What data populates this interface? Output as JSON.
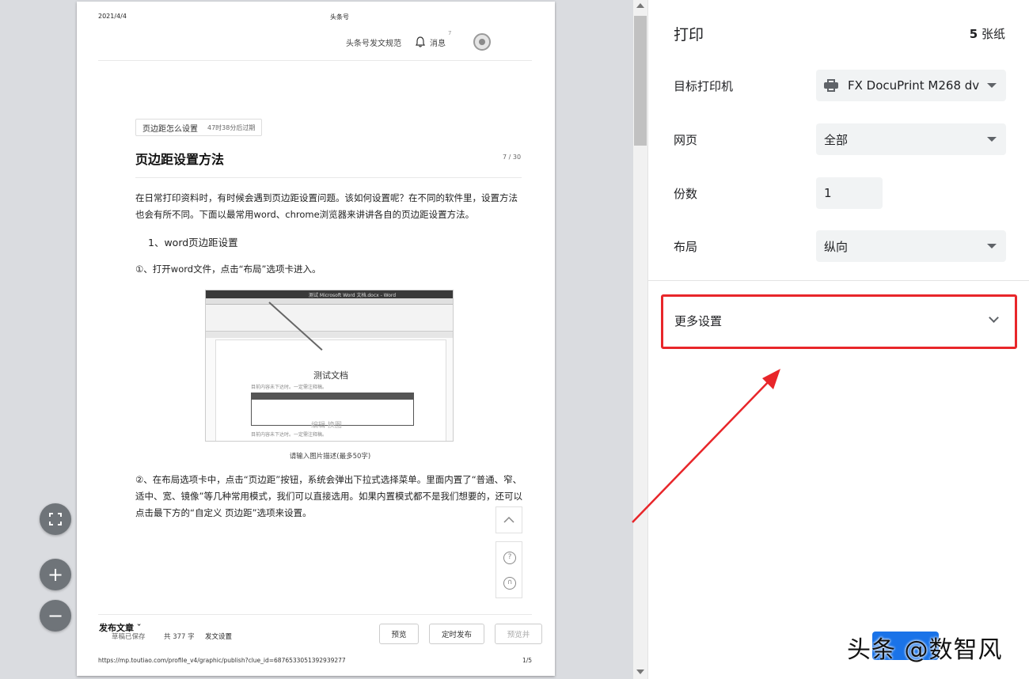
{
  "page": {
    "date": "2021/4/4",
    "site_title": "头条号",
    "nav_link": "头条号发文规范",
    "messages": "消息",
    "message_count": "7",
    "tag": "页边距怎么设置",
    "tag_time": "47时38分后过期",
    "article_title": "页边距设置方法",
    "counter": "7 / 30",
    "para1": "在日常打印资料时，有时候会遇到页边距设置问题。该如何设置呢？在不同的软件里，设置方法也会有所不同。下面以最常用word、chrome浏览器来讲讲各自的页边距设置方法。",
    "heading1": "1、word页边距设置",
    "step1": "①、打开word文件，点击“布局”选项卡进入。",
    "embed_window_title": "测试 Microsoft Word 文档.docx - Word",
    "embed_doc_title": "测试文档",
    "embed_doc_line": "目前内容未下达时。一定需注释稿。",
    "embed_watermark": "编辑    换图",
    "caption": "请输入图片描述(最多50字)",
    "step2": "②、在布局选项卡中，点击“页边距”按钮，系统会弹出下拉式选择菜单。里面内置了“普通、窄、适中、宽、镜像”等几种常用模式，我们可以直接选用。如果内置模式都不是我们想要的，还可以点击最下方的“自定义 页边距”选项来设置。",
    "publish_title": "发布文章",
    "publish_saved": "草稿已保存",
    "word_count": "共 377 字",
    "publish_settings": "发文设置",
    "preview_btn": "预览",
    "schedule_btn": "定时发布",
    "preview_publish_btn": "预览并",
    "url": "https://mp.toutiao.com/profile_v4/graphic/publish?clue_id=6876533051392939277",
    "page_num": "1/5"
  },
  "zoom": {
    "fit": "⛶",
    "plus": "+",
    "minus": "−"
  },
  "settings": {
    "title": "打印",
    "sheets_num": "5",
    "sheets_unit": "张纸",
    "destination_label": "目标打印机",
    "destination_value": "FX DocuPrint M268 dv",
    "pages_label": "网页",
    "pages_value": "全部",
    "copies_label": "份数",
    "copies_value": "1",
    "layout_label": "布局",
    "layout_value": "纵向",
    "more_settings": "更多设置"
  },
  "watermark": "头条 @数智风",
  "colors": {
    "highlight": "#e8262a",
    "primary_button": "#1a73e8"
  }
}
